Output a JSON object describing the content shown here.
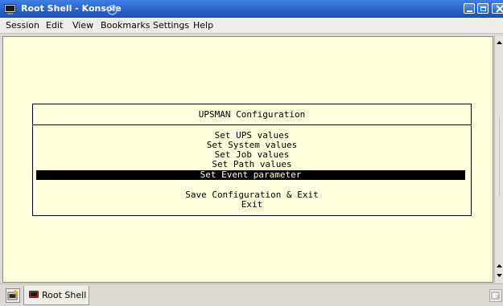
{
  "window": {
    "title": "Root Shell - Konsole"
  },
  "menubar": {
    "items": [
      "Session",
      "Edit",
      "View",
      "Bookmarks",
      "Settings",
      "Help"
    ]
  },
  "terminal": {
    "dialog_title": "UPSMAN Configuration",
    "menu": [
      "Set UPS values",
      "Set System values",
      "Set Job values",
      "Set Path values",
      "Set Event parameter"
    ],
    "selected_index": 4,
    "actions": [
      "Save Configuration & Exit",
      "Exit"
    ],
    "colors": {
      "background": "#ffffdd",
      "foreground": "#000000",
      "highlight": "#000000"
    }
  },
  "tabs": [
    {
      "label": "Root Shell",
      "icon": "terminal-icon"
    }
  ],
  "icons": {
    "app": "konsole-icon",
    "title_status": "clock-icon",
    "minimize": "minimize-icon",
    "maximize": "maximize-icon",
    "close": "close-icon",
    "new_tab": "new-session-icon",
    "close_tab": "close-session-icon"
  }
}
